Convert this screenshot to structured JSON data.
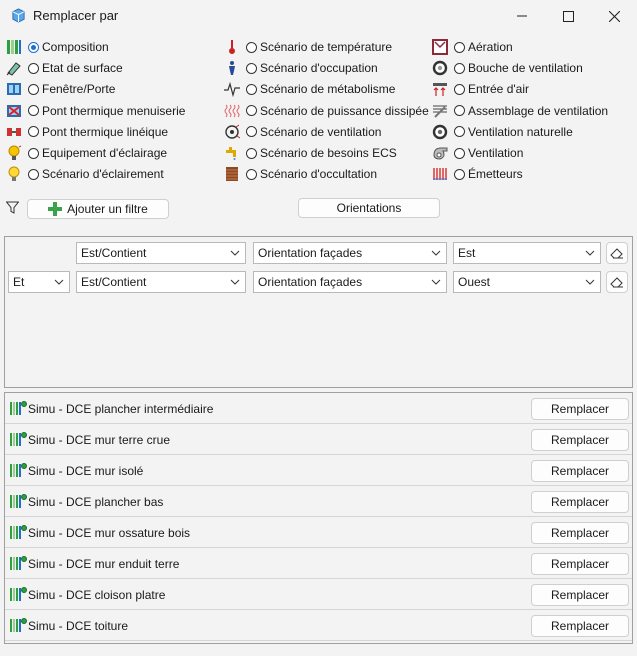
{
  "window": {
    "title": "Remplacer par"
  },
  "options": [
    {
      "label": "Composition",
      "icon": "composition-icon",
      "checked": true
    },
    {
      "label": "Etat de surface",
      "icon": "surface-state-icon",
      "checked": false
    },
    {
      "label": "Fenêtre/Porte",
      "icon": "window-door-icon",
      "checked": false
    },
    {
      "label": "Pont thermique menuiserie",
      "icon": "joinery-thermal-bridge-icon",
      "checked": false
    },
    {
      "label": "Pont thermique linéique",
      "icon": "linear-thermal-bridge-icon",
      "checked": false
    },
    {
      "label": "Equipement d'éclairage",
      "icon": "lighting-equipment-icon",
      "checked": false
    },
    {
      "label": "Scénario d'éclairement",
      "icon": "lighting-scenario-icon",
      "checked": false
    },
    {
      "label": "Scénario de température",
      "icon": "thermometer-icon",
      "checked": false
    },
    {
      "label": "Scénario d'occupation",
      "icon": "occupant-icon",
      "checked": false
    },
    {
      "label": "Scénario de métabolisme",
      "icon": "pulse-icon",
      "checked": false
    },
    {
      "label": "Scénario de puissance dissipée",
      "icon": "heat-dissipation-icon",
      "checked": false
    },
    {
      "label": "Scénario de ventilation",
      "icon": "ventilation-scenario-icon",
      "checked": false
    },
    {
      "label": "Scénario de besoins ECS",
      "icon": "faucet-icon",
      "checked": false
    },
    {
      "label": "Scénario d'occultation",
      "icon": "shutter-icon",
      "checked": false
    },
    {
      "label": "Aération",
      "icon": "opening-window-icon",
      "checked": false
    },
    {
      "label": "Bouche de ventilation",
      "icon": "vent-outlet-icon",
      "checked": false
    },
    {
      "label": "Entrée d'air",
      "icon": "air-inlet-icon",
      "checked": false
    },
    {
      "label": "Assemblage de ventilation",
      "icon": "ventilation-assembly-icon",
      "checked": false
    },
    {
      "label": "Ventilation naturelle",
      "icon": "natural-ventilation-icon",
      "checked": false
    },
    {
      "label": "Ventilation",
      "icon": "fan-icon",
      "checked": false
    },
    {
      "label": "Émetteurs",
      "icon": "radiator-icon",
      "checked": false
    }
  ],
  "toolbar": {
    "add_filter": "Ajouter un filtre",
    "orientations": "Orientations"
  },
  "filters": [
    {
      "conjunction": "",
      "field": "Est/Contient",
      "property": "Orientation façades",
      "value": "Est"
    },
    {
      "conjunction": "Et",
      "field": "Est/Contient",
      "property": "Orientation façades",
      "value": "Ouest"
    }
  ],
  "items": [
    {
      "name": "Simu - DCE plancher intermédiaire",
      "action": "Remplacer"
    },
    {
      "name": "Simu - DCE mur terre crue",
      "action": "Remplacer"
    },
    {
      "name": "Simu - DCE mur isolé",
      "action": "Remplacer"
    },
    {
      "name": "Simu - DCE  plancher bas",
      "action": "Remplacer"
    },
    {
      "name": "Simu - DCE mur ossature bois",
      "action": "Remplacer"
    },
    {
      "name": "Simu - DCE mur enduit terre",
      "action": "Remplacer"
    },
    {
      "name": "Simu - DCE cloison platre",
      "action": "Remplacer"
    },
    {
      "name": "Simu - DCE toiture",
      "action": "Remplacer"
    }
  ],
  "colors": {
    "accent": "#1f6fd1",
    "composition_green": "#2e9e3e"
  }
}
